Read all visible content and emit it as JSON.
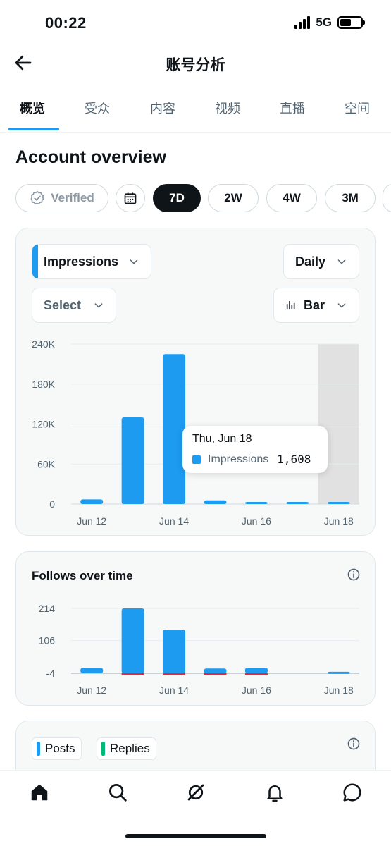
{
  "status_bar": {
    "time": "00:22",
    "network": "5G"
  },
  "header": {
    "title": "账号分析"
  },
  "tabs": [
    {
      "label": "概览",
      "active": true
    },
    {
      "label": "受众",
      "active": false
    },
    {
      "label": "内容",
      "active": false
    },
    {
      "label": "视频",
      "active": false
    },
    {
      "label": "直播",
      "active": false
    },
    {
      "label": "空间",
      "active": false
    }
  ],
  "overview": {
    "title": "Account overview",
    "filters": {
      "verified": "Verified",
      "ranges": [
        "7D",
        "2W",
        "4W",
        "3M"
      ],
      "selected_range": "7D"
    }
  },
  "impressions_card": {
    "metric": "Impressions",
    "interval": "Daily",
    "compare": "Select",
    "chart_style": "Bar",
    "tooltip": {
      "date": "Thu, Jun 18",
      "series": "Impressions",
      "value": "1,608"
    }
  },
  "follows_card": {
    "title": "Follows over time"
  },
  "posts_card": {
    "chips": [
      "Posts",
      "Replies"
    ]
  },
  "colors": {
    "accent": "#1d9bf0",
    "negative": "#f4212e",
    "replies": "#00ba7c",
    "highlight": "#e1e1e1"
  },
  "chart_data": [
    {
      "type": "bar",
      "title": "Impressions",
      "categories": [
        "Jun 12",
        "Jun 13",
        "Jun 14",
        "Jun 15",
        "Jun 16",
        "Jun 17",
        "Jun 18"
      ],
      "x_tick_labels": [
        "Jun 12",
        "",
        "Jun 14",
        "",
        "Jun 16",
        "",
        "Jun 18"
      ],
      "values": [
        7000,
        130000,
        225000,
        5500,
        3000,
        2500,
        1608
      ],
      "y_ticks": [
        "0",
        "60K",
        "120K",
        "180K",
        "240K"
      ],
      "ylim": [
        0,
        240000
      ],
      "highlighted_index": 6,
      "grid": true
    },
    {
      "type": "bar",
      "title": "Follows over time",
      "categories": [
        "Jun 12",
        "Jun 13",
        "Jun 14",
        "Jun 15",
        "Jun 16",
        "Jun 17",
        "Jun 18"
      ],
      "x_tick_labels": [
        "Jun 12",
        "",
        "Jun 14",
        "",
        "Jun 16",
        "",
        "Jun 18"
      ],
      "series": [
        {
          "values": [
            14,
            214,
            143,
            12,
            15,
            0,
            1
          ]
        },
        {
          "values": [
            0,
            -2,
            -1,
            -1,
            -1,
            0,
            0
          ]
        }
      ],
      "y_ticks": [
        "-4",
        "106",
        "214"
      ],
      "ylim": [
        -4,
        214
      ],
      "grid": true
    }
  ]
}
